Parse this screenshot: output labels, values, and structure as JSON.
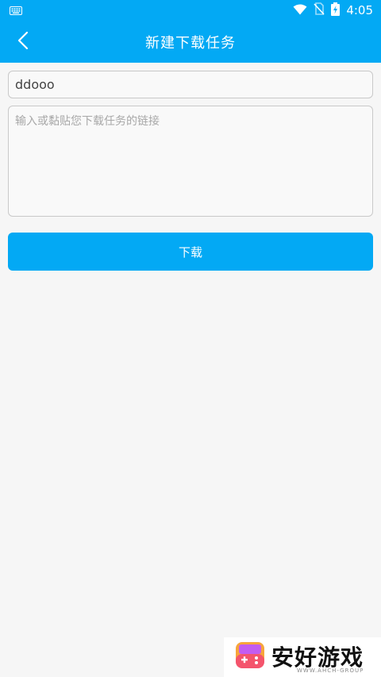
{
  "status_bar": {
    "time": "4:05",
    "icons": [
      "keyboard-icon",
      "wifi-icon",
      "no-sim-icon",
      "battery-charging-icon"
    ]
  },
  "app_bar": {
    "title": "新建下载任务",
    "back_icon": "chevron-left-icon"
  },
  "form": {
    "name_value": "ddooo",
    "link_value": "",
    "link_placeholder": "输入或黏贴您下载任务的链接",
    "download_label": "下载"
  },
  "watermark": {
    "title": "安好游戏",
    "subtitle": "WWW.AHCH-GROUP",
    "logo_icon": "handheld-console-icon"
  },
  "colors": {
    "primary": "#03a9f4",
    "background": "#f6f6f6"
  }
}
